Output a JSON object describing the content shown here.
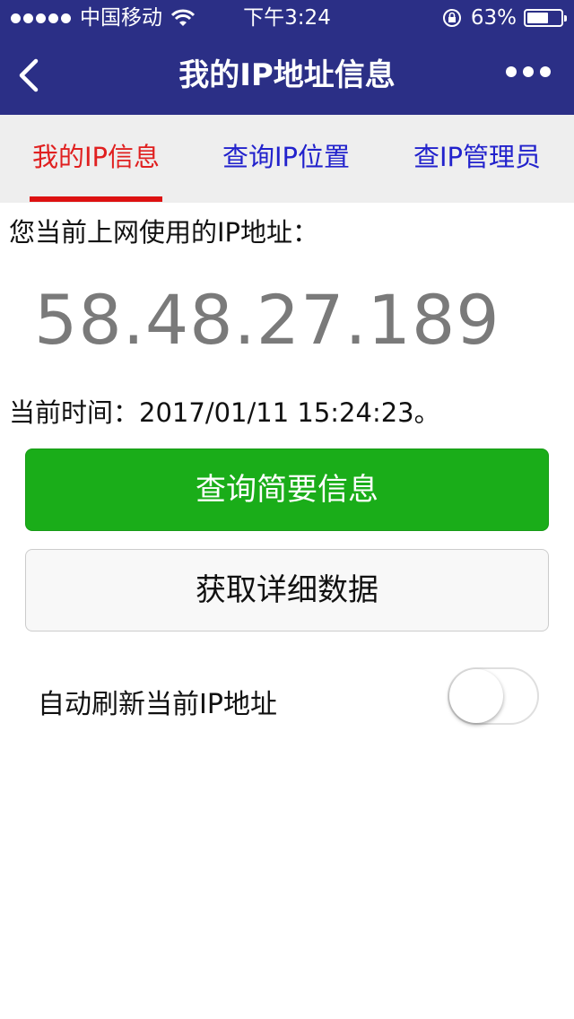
{
  "status_bar": {
    "carrier": "中国移动",
    "time": "下午3:24",
    "battery_percent": "63%",
    "battery_level": 0.63
  },
  "nav": {
    "title": "我的IP地址信息"
  },
  "tabs": [
    {
      "label": "我的IP信息",
      "active": true
    },
    {
      "label": "查询IP位置",
      "active": false
    },
    {
      "label": "查IP管理员",
      "active": false
    }
  ],
  "content": {
    "ip_label": "您当前上网使用的IP地址：",
    "ip_address": "58.48.27.189",
    "time_label": "当前时间：",
    "time_value": "2017/01/11 15:24:23。"
  },
  "buttons": {
    "query_summary": "查询简要信息",
    "get_details": "获取详细数据"
  },
  "auto_refresh": {
    "label": "自动刷新当前IP地址",
    "enabled": false
  },
  "colors": {
    "nav_bg": "#2b2f86",
    "tab_active": "#e02020",
    "tab_inactive": "#2222cc",
    "primary_button": "#1aad19"
  }
}
